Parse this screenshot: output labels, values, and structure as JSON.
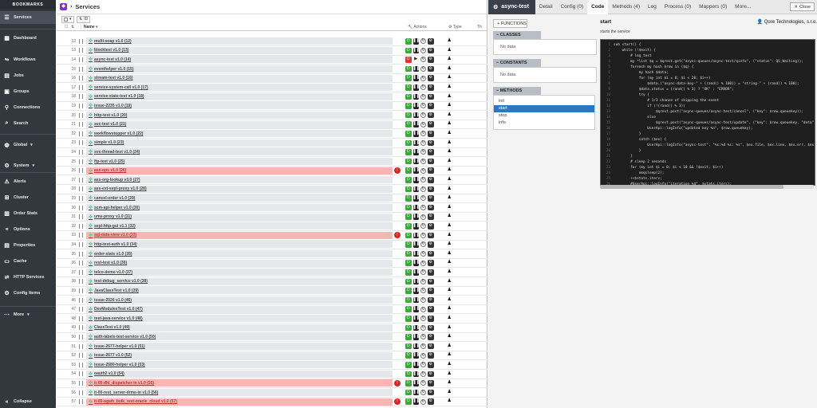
{
  "sidebar": {
    "brand": "BOOKMARKS",
    "items": [
      {
        "label": "Services",
        "icon": "hamburger-icon",
        "active": true
      },
      {
        "label": "Dashboard",
        "icon": "dashboard-icon"
      },
      {
        "label": "Workflows",
        "icon": "workflow-icon"
      },
      {
        "label": "Jobs",
        "icon": "calendar-icon"
      },
      {
        "label": "Groups",
        "icon": "group-icon"
      },
      {
        "label": "Connections",
        "icon": "plug-icon"
      },
      {
        "label": "Search",
        "icon": "search-icon"
      },
      {
        "label": "Global",
        "icon": "globe-icon"
      },
      {
        "label": "System",
        "icon": "cog-icon"
      },
      {
        "label": "Alerts",
        "icon": "warning-icon"
      },
      {
        "label": "Cluster",
        "icon": "cluster-icon"
      },
      {
        "label": "Order Stats",
        "icon": "chart-icon"
      },
      {
        "label": "Options",
        "icon": "sliders-icon"
      },
      {
        "label": "Properties",
        "icon": "properties-icon"
      },
      {
        "label": "Cache",
        "icon": "cache-icon"
      },
      {
        "label": "HTTP Services",
        "icon": "http-icon"
      },
      {
        "label": "Config Items",
        "icon": "config-icon"
      },
      {
        "label": "More",
        "icon": "dots-icon"
      }
    ],
    "collapse_label": "Collapse"
  },
  "services": {
    "title": "Services",
    "sort_field": "ID",
    "columns": {
      "name": "Name",
      "actions": "Actions",
      "type": "Type",
      "th": "Th"
    },
    "rows": [
      {
        "id": 12,
        "name": "multi-soap v1.0 (12)"
      },
      {
        "id": 13,
        "name": "blocktest v1.0 (13)"
      },
      {
        "id": 14,
        "name": "async-test v1.0 (14)",
        "stopped": true
      },
      {
        "id": 15,
        "name": "eventhelper v1.0 (15)"
      },
      {
        "id": 16,
        "name": "stream-test v1.0 (16)"
      },
      {
        "id": 17,
        "name": "service-system-call v1.0 (17)"
      },
      {
        "id": 18,
        "name": "service-state-test v1.0 (18)"
      },
      {
        "id": 19,
        "name": "issue-2235 v1.0 (19)"
      },
      {
        "id": 20,
        "name": "http-test v1.0 (20)"
      },
      {
        "id": 21,
        "name": "svc-test v1.0 (21)"
      },
      {
        "id": 22,
        "name": "workflowstopper v1.0 (22)"
      },
      {
        "id": 23,
        "name": "simple v1.0 (23)"
      },
      {
        "id": 24,
        "name": "svc-thread-test v1.0 (24)"
      },
      {
        "id": 25,
        "name": "ftp-test v1.0 (25)"
      },
      {
        "id": 26,
        "name": "ass-ops v1.0 (26)",
        "alert": true
      },
      {
        "id": 27,
        "name": "ass-org-lookup v3.0 (27)"
      },
      {
        "id": 28,
        "name": "ass-ext-sepl-proxy v1.0 (28)"
      },
      {
        "id": 29,
        "name": "cancel-order v1.0 (29)"
      },
      {
        "id": 30,
        "name": "scm-api-helper v1.0 (30)"
      },
      {
        "id": 31,
        "name": "ums-proxy v1.0 (31)"
      },
      {
        "id": 32,
        "name": "sepl-http-gui v1.1 (32)"
      },
      {
        "id": 33,
        "name": "sql-data-view v1.0 (33)",
        "alert": true
      },
      {
        "id": 34,
        "name": "http-test-auth v1.0 (34)"
      },
      {
        "id": 35,
        "name": "order-stats v1.0 (35)"
      },
      {
        "id": 36,
        "name": "rest-test v1.0 (36)"
      },
      {
        "id": 37,
        "name": "telco-demo v1.0 (37)"
      },
      {
        "id": 38,
        "name": "test-debug_service v1.0 (38)"
      },
      {
        "id": 39,
        "name": "JavaClassTest v1.0 (39)"
      },
      {
        "id": 46,
        "name": "issue-2526 v1.0 (46)"
      },
      {
        "id": 47,
        "name": "DevModulesTest v1.0 (47)"
      },
      {
        "id": 48,
        "name": "test-java-service v1.0 (48)"
      },
      {
        "id": 49,
        "name": "ClassTest v1.0 (49)"
      },
      {
        "id": 50,
        "name": "auth-labels-test-service v1.0 (50)"
      },
      {
        "id": 51,
        "name": "issue-2677-helper v1.0 (51)"
      },
      {
        "id": 52,
        "name": "issue-2677 v1.0 (52)"
      },
      {
        "id": 53,
        "name": "issue-2680-helper v1.0 (53)"
      },
      {
        "id": 54,
        "name": "oauth2 v1.0 (54)"
      },
      {
        "id": 55,
        "name": "it-00-dhl_dispatcher-in v1.0 (55)",
        "alert": true
      },
      {
        "id": 56,
        "name": "it-00-rest_server-drms-in v1.0 (56)"
      },
      {
        "id": 57,
        "name": "it-00-ogwh_bulk_rest-oracle_cloud v1.0 (57)",
        "alert": true
      }
    ]
  },
  "detail": {
    "title": "async-test",
    "tabs": [
      "Detail",
      "Config (0)",
      "Code",
      "Methods (4)",
      "Log",
      "Process (0)",
      "Mappers (0)",
      "More..."
    ],
    "active_tab": "Code",
    "close_label": "Close",
    "functions_label": "FUNCTIONS",
    "classes_label": "CLASSES",
    "classes_empty": "No data",
    "constants_label": "CONSTANTS",
    "constants_empty": "No data",
    "methods_label": "METHODS",
    "methods": [
      "init",
      "start",
      "stop",
      "info"
    ],
    "selected_method": "start",
    "code_title": "start",
    "code_owner": "Qore Technologies, s.r.o.",
    "code_desc": "starts the service",
    "code": "sub start() {\n    while (!$exit) {\n        # log_test\n        my *list $q = $qrest.get(\"async-queues/async-test/qinfo\", (\"status\": QS_Waiting));\n        foreach my hash $row in ($q) {\n            my hash $data;\n            for (my int $i = 0; $i < 20; $i++)\n                $data.(\"async-data-key-\" + (rand() % 100)) = \"string-\" + (rand() % 100);\n            $data.status = (rand() % 3) ? \"OK\" : \"ERROR\";\n            try {\n                # 1/3 chance of skipping the event\n                if (!(rand() % 3))\n                    $qrest.post(\"async-queues/async-test/cancel\", (\"key\": $row.queuekey));\n                else\n                    $qrest.post(\"async-queues/async-test/update\", (\"key\": $row.queuekey, \"data\": $data));\n                UserApi::logInfo(\"updated key %n\", $row.queuekey);\n            }\n            catch ($ex) {\n                UserApi::logInfo(\"async-test\", \"%s:%d %s: %s\", $ex.file, $ex.line, $ex.err, $ex.desc);\n            }\n        }\n        # sleep 2 seconds\n        for (my int $i = 0; $i < 10 && !$exit; $i++)\n            omqsleep(2);\n        ++$stats.iters;\n        #UserApi::logInfo(\"iteration %d\", $stats.iters);\n    }\n}",
    "code_line_count": 27
  }
}
